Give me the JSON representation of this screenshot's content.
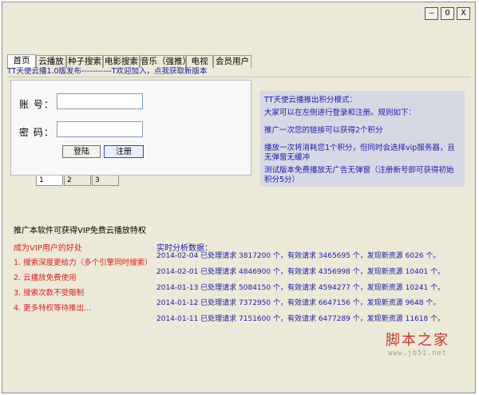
{
  "window_controls": {
    "minimize": "–",
    "restore": "O",
    "close": "X"
  },
  "tabs": [
    {
      "label": "首页"
    },
    {
      "label": "云播放"
    },
    {
      "label": "种子搜索"
    },
    {
      "label": "电影搜索"
    },
    {
      "label": "音乐（强推）"
    },
    {
      "label": "电视"
    },
    {
      "label": "会员用户"
    }
  ],
  "marquee": "TT天使云播1.0版发布-----------T欢迎加入，点我获取新版本",
  "login": {
    "account_label": "账 号：",
    "password_label": "密 码：",
    "account_value": "",
    "password_value": "",
    "login_button": "登陆",
    "register_button": "注册"
  },
  "pager": [
    "1",
    "2",
    "3"
  ],
  "info": {
    "title": "TT天使云播推出积分模式：",
    "lines": [
      "大家可以在左侧进行登录和注册。规则如下：",
      "推广一次您的链接可以获得2个积分",
      "播放一次将消耗您1个积分，但同时会选择vip服务器，且无弹窗无缓冲",
      "测试版本免费播放无广告无弹窗（注册新号即可获得初始积分5分）"
    ]
  },
  "promo": "推广本软件可获得VIP免费云播放特权",
  "vip": {
    "title": "成为VIP用户的好处",
    "items": [
      "1. 搜索深度更给力（多个引擎同时搜索）",
      "2. 云播放免费使用",
      "3. 搜索次数不受限制",
      "4. 更多特权等待推出..."
    ]
  },
  "stats": {
    "title": "实时分析数据：",
    "rows": [
      "2014-02-04 已处理请求 3817200 个，有效请求 3465695 个，发现新资源 6026 个。",
      "2014-02-01 已处理请求 4846900 个，有效请求 4356998 个，发现新资源 10401 个。",
      "2014-01-13 已处理请求 5084150 个，有效请求 4594277 个，发现新资源 10241 个。",
      "2014-01-12 已处理请求 7372950 个，有效请求 6647156 个，发现新资源 9648 个。",
      "2014-01-11 已处理请求 7151600 个，有效请求 6477289 个，发现新资源 11618 个。"
    ]
  },
  "watermark": {
    "title": "脚本之家",
    "url": "www.jb51.net"
  }
}
